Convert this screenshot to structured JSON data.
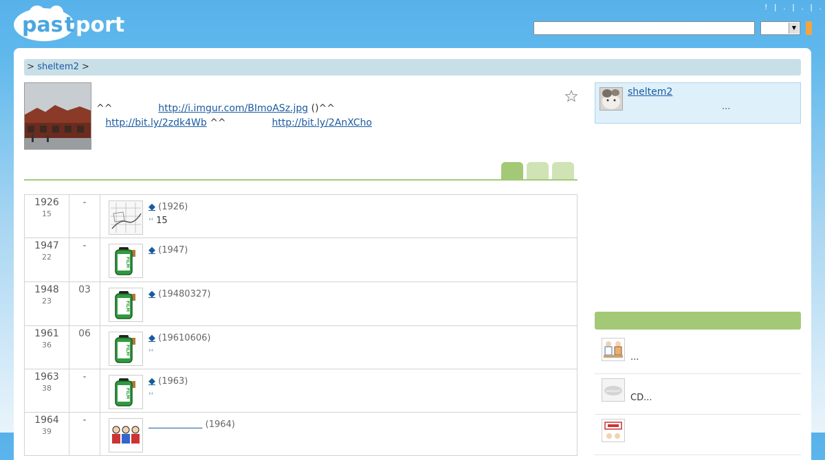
{
  "header": {
    "logo_text": "pastport",
    "links_text": "! | . | . | .",
    "search_placeholder": ""
  },
  "breadcrumb": {
    "prefix": ">",
    "item": "sheltem2",
    "suffix": ">"
  },
  "post": {
    "text1": "^^",
    "link1": "http://i.imgur.com/BImoASz.jpg",
    "text2": "()^^",
    "link2": "http://bit.ly/2zdk4Wb",
    "text3": "^^",
    "link3": "http://bit.ly/2AnXCho"
  },
  "timeline": [
    {
      "year": "1926",
      "sub": "15",
      "month": "-",
      "thumb": "map-icon",
      "date": "(1926)",
      "quote": "15",
      "linked": true
    },
    {
      "year": "1947",
      "sub": "22",
      "month": "-",
      "thumb": "film-icon",
      "date": "(1947)",
      "quote": "",
      "linked": true
    },
    {
      "year": "1948",
      "sub": "23",
      "month": "03",
      "thumb": "film-icon",
      "date": "(19480327)",
      "quote": "",
      "linked": true
    },
    {
      "year": "1961",
      "sub": "36",
      "month": "06",
      "thumb": "film-icon",
      "date": "(19610606)",
      "quote": "",
      "linked": true
    },
    {
      "year": "1963",
      "sub": "38",
      "month": "-",
      "thumb": "film-icon",
      "date": "(1963)",
      "quote": "",
      "linked": true
    },
    {
      "year": "1964",
      "sub": "39",
      "month": "-",
      "thumb": "people-icon",
      "date": "(1964)",
      "quote": "",
      "linked": false
    }
  ],
  "user": {
    "name": "sheltem2",
    "note": "..."
  },
  "sidebar": {
    "items": [
      {
        "text": "...",
        "icon": "people-icon"
      },
      {
        "text": "CD...",
        "icon": "pastport-placeholder-icon"
      },
      {
        "text": "",
        "icon": "sign-icon"
      }
    ]
  },
  "colors": {
    "header_blue": "#58b2ea",
    "accent_green": "#a3c977",
    "light_green": "#cfe3b4",
    "link_blue": "#1a5aa0",
    "search_button": "#f2a541"
  }
}
